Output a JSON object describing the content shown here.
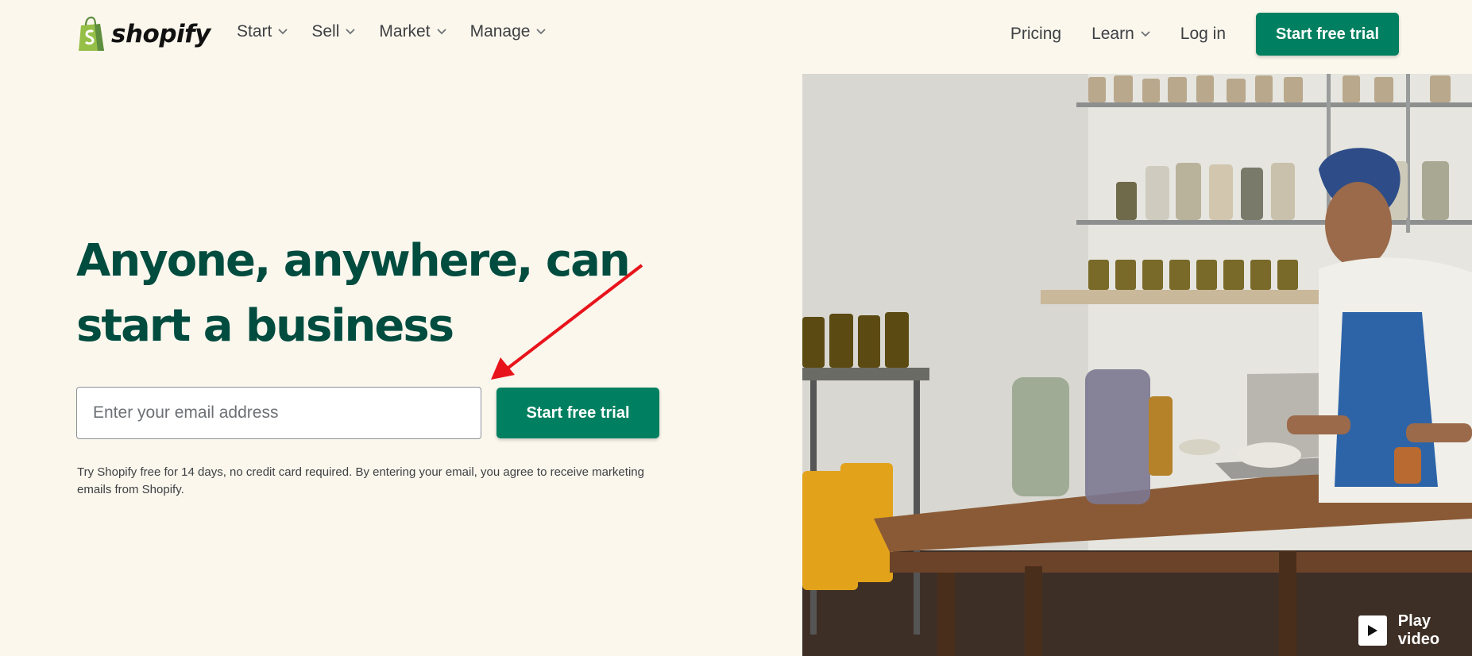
{
  "header": {
    "logo_text": "shopify",
    "nav": [
      {
        "label": "Start"
      },
      {
        "label": "Sell"
      },
      {
        "label": "Market"
      },
      {
        "label": "Manage"
      }
    ],
    "pricing_label": "Pricing",
    "learn_label": "Learn",
    "login_label": "Log in",
    "cta_label": "Start free trial"
  },
  "hero": {
    "headline_line1": "Anyone, anywhere, can",
    "headline_line2": "start a business",
    "email_placeholder": "Enter your email address",
    "cta_label": "Start free trial",
    "disclaimer": "Try Shopify free for 14 days, no credit card required. By entering your email, you agree to receive marketing emails from Shopify.",
    "play_label": "Play video"
  },
  "colors": {
    "background": "#fbf7ed",
    "brand_green": "#008060",
    "headline_green": "#004c3f",
    "annotation_arrow": "#e8141b"
  }
}
